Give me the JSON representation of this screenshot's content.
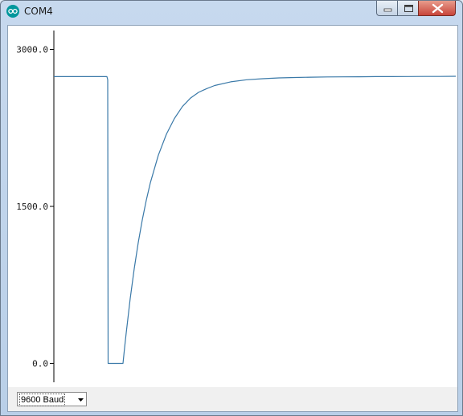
{
  "window": {
    "title": "COM4",
    "app_icon": "arduino-logo-icon",
    "caption_buttons": [
      "minimize-icon",
      "maximize-icon",
      "close-icon"
    ]
  },
  "colors": {
    "trace": "#3a79a8",
    "axis": "#000000",
    "close_button": "#c8453a"
  },
  "plotter": {
    "baud_select": {
      "selected": "9600 Baud"
    }
  },
  "chart_data": {
    "type": "line",
    "y_ticks": [
      "3000.0",
      "1500.0",
      "0.0"
    ],
    "y_tick_values": [
      3000,
      1500,
      0
    ],
    "ylim": [
      -150,
      3150
    ],
    "xlim": [
      0,
      500
    ],
    "grid": false,
    "series": [
      {
        "x": [
          0,
          66,
          67,
          67.5,
          80,
          86,
          88,
          90,
          95,
          100,
          105,
          110,
          115,
          120,
          130,
          140,
          150,
          160,
          170,
          180,
          190,
          200,
          220,
          240,
          260,
          280,
          300,
          320,
          340,
          360,
          380,
          400,
          420,
          440,
          460,
          480,
          500
        ],
        "y": [
          2740,
          2740,
          2710,
          0,
          0,
          0,
          150,
          290,
          620,
          905,
          1155,
          1370,
          1560,
          1725,
          1990,
          2190,
          2340,
          2455,
          2535,
          2590,
          2625,
          2655,
          2690,
          2710,
          2720,
          2728,
          2732,
          2735,
          2737,
          2738,
          2739,
          2740,
          2740,
          2741,
          2742,
          2742,
          2743
        ]
      }
    ]
  }
}
